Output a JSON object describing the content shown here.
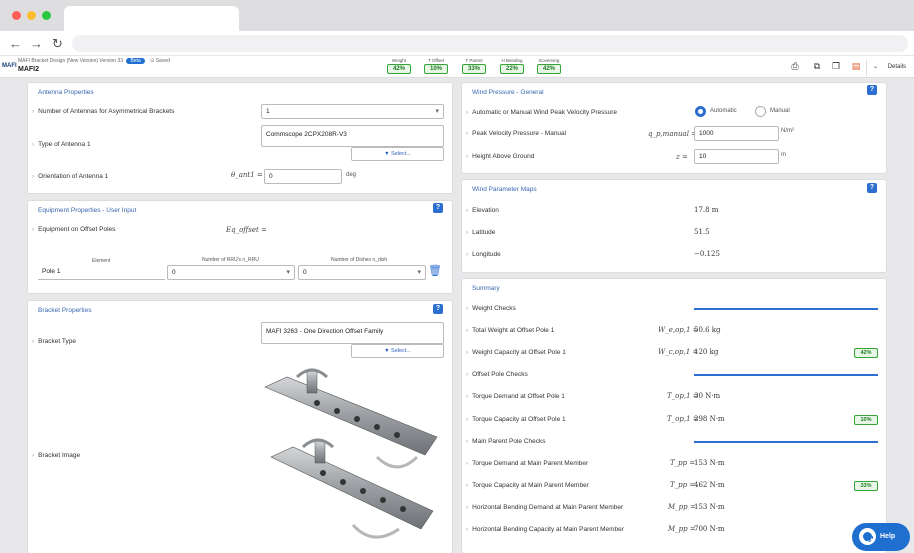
{
  "app": {
    "subtitle": "MAFI Bracket Design (New Version) Version 33",
    "beta_label": "Beta",
    "saved_label": "Saved",
    "name": "MAFI2",
    "logo": "MAFI",
    "details_label": "Details"
  },
  "metrics": [
    {
      "label": "Weight",
      "value": "42%"
    },
    {
      "label": "T Offset",
      "value": "10%"
    },
    {
      "label": "T Parent",
      "value": "33%"
    },
    {
      "label": "H Bending",
      "value": "22%"
    },
    {
      "label": "Governing",
      "value": "42%"
    }
  ],
  "antenna": {
    "title": "Antenna Properties",
    "num_label": "Number of Antennas for Asymmetrical Brackets",
    "num_value": "1",
    "type_label": "Type of Antenna 1",
    "type_value": "Commscope 2CPX208R-V3",
    "select_label": "Select...",
    "orient_label": "Orientation of Antenna 1",
    "orient_symbol": "θ_ant1 =",
    "orient_value": "0",
    "orient_unit": "deg"
  },
  "equipment": {
    "title": "Equipment Properties - User Input",
    "offset_label": "Equipment on Offset Poles",
    "offset_symbol": "Eq_offset =",
    "col_element": "Element",
    "col_rrus": "Number of RRU's n_RRU",
    "col_dishes": "Number of Dishes n_dish",
    "pole_value": "Pole 1",
    "rrus_value": "0",
    "dishes_value": "0"
  },
  "bracket": {
    "title": "Bracket Properties",
    "type_label": "Bracket Type",
    "type_value": "MAFI 3263 - One Direction Offset Family",
    "select_label": "Select...",
    "image_label": "Bracket Image"
  },
  "wind_pressure": {
    "title": "Wind Pressure - General",
    "mode_label": "Automatic or Manual Wind Peak Velocity Pressure",
    "auto_label": "Automatic",
    "manual_label": "Manual",
    "peak_label": "Peak Velocity Pressure - Manual",
    "peak_symbol": "q_p,manual =",
    "peak_value": "1000",
    "peak_unit": "N/m²",
    "height_label": "Height Above Ground",
    "height_symbol": "z =",
    "height_value": "10",
    "height_unit": "m"
  },
  "wind_maps": {
    "title": "Wind Parameter Maps",
    "rows": [
      {
        "label": "Elevation",
        "value": "17.8 m"
      },
      {
        "label": "Latitude",
        "value": "51.5"
      },
      {
        "label": "Longitude",
        "value": "−0.125"
      }
    ]
  },
  "summary": {
    "title": "Summary",
    "sections": [
      {
        "label": "Weight Checks",
        "rows": [
          {
            "label": "Total Weight at Offset Pole 1",
            "symbol": "W_e,op,1 =",
            "value": "50.6 kg",
            "badge": ""
          },
          {
            "label": "Weight Capacity at Offset Pole 1",
            "symbol": "W_c,op,1 =",
            "value": "120 kg",
            "badge": "42%"
          }
        ]
      },
      {
        "label": "Offset Pole Checks",
        "rows": [
          {
            "label": "Torque Demand at Offset Pole 1",
            "symbol": "T_op,1 =",
            "value": "30 N·m",
            "badge": ""
          },
          {
            "label": "Torque Capacity at Offset Pole 1",
            "symbol": "T_op,1 =",
            "value": "298 N·m",
            "badge": "10%"
          }
        ]
      },
      {
        "label": "Main Parent Pole Checks",
        "rows": [
          {
            "label": "Torque Demand at Main Parent Member",
            "symbol": "T_pp =",
            "value": "153 N·m",
            "badge": ""
          },
          {
            "label": "Torque Capacity at Main Parent Member",
            "symbol": "T_pp =",
            "value": "462 N·m",
            "badge": "33%"
          },
          {
            "label": "Horizontal Bending Demand at Main Parent Member",
            "symbol": "M_pp =",
            "value": "153 N·m",
            "badge": ""
          },
          {
            "label": "Horizontal Bending Capacity at Main Parent Member",
            "symbol": "M_pp =",
            "value": "700 N·m",
            "badge": ""
          }
        ]
      }
    ]
  },
  "help_label": "Help",
  "colors": {
    "accent": "#2d6fd1",
    "ok": "#33a433"
  }
}
